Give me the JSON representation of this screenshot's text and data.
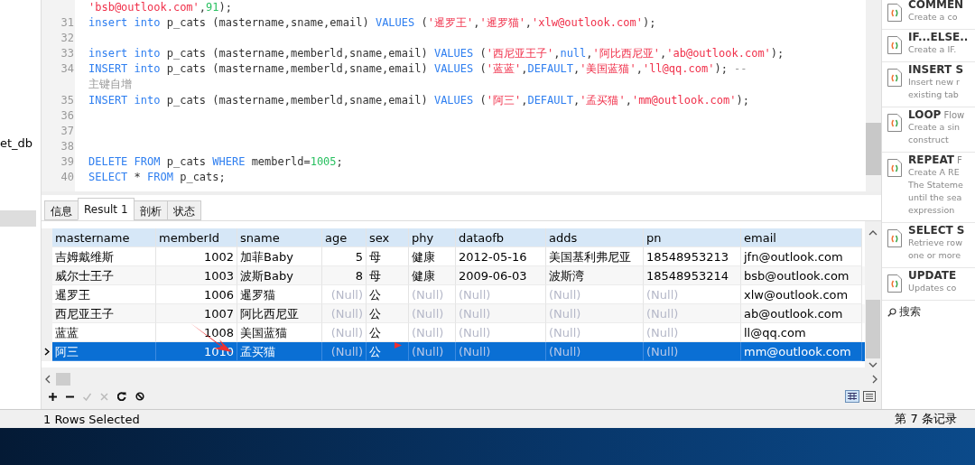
{
  "navigator": {
    "item_label": "et_db"
  },
  "editor": {
    "lines": [
      {
        "tokens": [
          {
            "kind": "str",
            "text": "'bsb@outlook.com'"
          },
          {
            "kind": "plain",
            "text": ","
          },
          {
            "kind": "num",
            "text": "91"
          },
          {
            "kind": "plain",
            "text": ");"
          }
        ]
      },
      {
        "number": "31",
        "tokens": [
          {
            "kind": "kw",
            "text": "insert into"
          },
          {
            "kind": "plain",
            "text": " p_cats (mastername,sname,email) "
          },
          {
            "kind": "kw",
            "text": "VALUES"
          },
          {
            "kind": "plain",
            "text": " ("
          },
          {
            "kind": "str",
            "text": "'暹罗王'"
          },
          {
            "kind": "plain",
            "text": ","
          },
          {
            "kind": "str",
            "text": "'暹罗猫'"
          },
          {
            "kind": "plain",
            "text": ","
          },
          {
            "kind": "str",
            "text": "'xlw@outlook.com'"
          },
          {
            "kind": "plain",
            "text": ");"
          }
        ]
      },
      {
        "number": "32"
      },
      {
        "number": "33",
        "tokens": [
          {
            "kind": "kw",
            "text": "insert into"
          },
          {
            "kind": "plain",
            "text": " p_cats (mastername,memberld,sname,email) "
          },
          {
            "kind": "kw",
            "text": "VALUES"
          },
          {
            "kind": "plain",
            "text": " ("
          },
          {
            "kind": "str",
            "text": "'西尼亚王子'"
          },
          {
            "kind": "plain",
            "text": ","
          },
          {
            "kind": "kw",
            "text": "null"
          },
          {
            "kind": "plain",
            "text": ","
          },
          {
            "kind": "str",
            "text": "'阿比西尼亚'"
          },
          {
            "kind": "plain",
            "text": ","
          },
          {
            "kind": "str",
            "text": "'ab@outlook.com'"
          },
          {
            "kind": "plain",
            "text": ");"
          }
        ]
      },
      {
        "number": "34",
        "tokens": [
          {
            "kind": "kw",
            "text": "INSERT into"
          },
          {
            "kind": "plain",
            "text": " p_cats (mastername,memberld,sname,email) "
          },
          {
            "kind": "kw",
            "text": "VALUES"
          },
          {
            "kind": "plain",
            "text": " ("
          },
          {
            "kind": "str",
            "text": "'蓝蓝'"
          },
          {
            "kind": "plain",
            "text": ","
          },
          {
            "kind": "kw",
            "text": "DEFAULT"
          },
          {
            "kind": "plain",
            "text": ","
          },
          {
            "kind": "str",
            "text": "'美国蓝猫'"
          },
          {
            "kind": "plain",
            "text": ","
          },
          {
            "kind": "str",
            "text": "'ll@qq.com'"
          },
          {
            "kind": "plain",
            "text": "); "
          },
          {
            "kind": "comment",
            "text": "--"
          }
        ]
      },
      {
        "tokens": [
          {
            "kind": "comment",
            "text": "主键自增"
          }
        ]
      },
      {
        "number": "35",
        "tokens": [
          {
            "kind": "kw",
            "text": "INSERT into"
          },
          {
            "kind": "plain",
            "text": " p_cats (mastername,memberld,sname,email) "
          },
          {
            "kind": "kw",
            "text": "VALUES"
          },
          {
            "kind": "plain",
            "text": " ("
          },
          {
            "kind": "str",
            "text": "'阿三'"
          },
          {
            "kind": "plain",
            "text": ","
          },
          {
            "kind": "kw",
            "text": "DEFAULT"
          },
          {
            "kind": "plain",
            "text": ","
          },
          {
            "kind": "str",
            "text": "'孟买猫'"
          },
          {
            "kind": "plain",
            "text": ","
          },
          {
            "kind": "str",
            "text": "'mm@outlook.com'"
          },
          {
            "kind": "plain",
            "text": ");"
          }
        ]
      },
      {
        "number": "36"
      },
      {
        "number": "37"
      },
      {
        "number": "38"
      },
      {
        "number": "39",
        "tokens": [
          {
            "kind": "kw",
            "text": "DELETE FROM"
          },
          {
            "kind": "plain",
            "text": " p_cats "
          },
          {
            "kind": "kw",
            "text": "WHERE"
          },
          {
            "kind": "plain",
            "text": " memberld="
          },
          {
            "kind": "num",
            "text": "1005"
          },
          {
            "kind": "plain",
            "text": ";"
          }
        ]
      },
      {
        "number": "40",
        "tokens": [
          {
            "kind": "kw",
            "text": "SELECT"
          },
          {
            "kind": "plain",
            "text": " * "
          },
          {
            "kind": "kw",
            "text": "FROM"
          },
          {
            "kind": "plain",
            "text": " p_cats;"
          }
        ]
      }
    ]
  },
  "tabs": [
    {
      "label": "信息",
      "selected": false
    },
    {
      "label": "Result 1",
      "selected": true
    },
    {
      "label": "剖析",
      "selected": false
    },
    {
      "label": "状态",
      "selected": false
    }
  ],
  "table": {
    "columns": [
      {
        "label": "mastername",
        "kind": "text"
      },
      {
        "label": "memberId",
        "kind": "number"
      },
      {
        "label": "sname",
        "kind": "text"
      },
      {
        "label": "age",
        "kind": "number"
      },
      {
        "label": "sex",
        "kind": "text"
      },
      {
        "label": "phy",
        "kind": "text"
      },
      {
        "label": "dataofb",
        "kind": "text"
      },
      {
        "label": "adds",
        "kind": "text"
      },
      {
        "label": "pn",
        "kind": "text"
      },
      {
        "label": "email",
        "kind": "text"
      }
    ],
    "rows": [
      {
        "selected": false,
        "cells": [
          {
            "text": "吉姆戴维斯",
            "null": false
          },
          {
            "text": "1002",
            "null": false
          },
          {
            "text": "加菲Baby",
            "null": false
          },
          {
            "text": "5",
            "null": false
          },
          {
            "text": "母",
            "null": false
          },
          {
            "text": "健康",
            "null": false
          },
          {
            "text": "2012-05-16",
            "null": false
          },
          {
            "text": "美国基利弗尼亚",
            "null": false
          },
          {
            "text": "18548953213",
            "null": false
          },
          {
            "text": "jfn@outlook.com",
            "null": false
          }
        ]
      },
      {
        "selected": false,
        "cells": [
          {
            "text": "威尔士王子",
            "null": false
          },
          {
            "text": "1003",
            "null": false
          },
          {
            "text": "波斯Baby",
            "null": false
          },
          {
            "text": "8",
            "null": false
          },
          {
            "text": "母",
            "null": false
          },
          {
            "text": "健康",
            "null": false
          },
          {
            "text": "2009-06-03",
            "null": false
          },
          {
            "text": "波斯湾",
            "null": false
          },
          {
            "text": "18548953214",
            "null": false
          },
          {
            "text": "bsb@outlook.com",
            "null": false
          }
        ]
      },
      {
        "selected": false,
        "cells": [
          {
            "text": "暹罗王",
            "null": false
          },
          {
            "text": "1006",
            "null": false
          },
          {
            "text": "暹罗猫",
            "null": false
          },
          {
            "text": "(Null)",
            "null": true
          },
          {
            "text": "公",
            "null": false
          },
          {
            "text": "(Null)",
            "null": true
          },
          {
            "text": "(Null)",
            "null": true
          },
          {
            "text": "(Null)",
            "null": true
          },
          {
            "text": "(Null)",
            "null": true
          },
          {
            "text": "xlw@outlook.com",
            "null": false
          }
        ]
      },
      {
        "selected": false,
        "cells": [
          {
            "text": "西尼亚王子",
            "null": false
          },
          {
            "text": "1007",
            "null": false
          },
          {
            "text": "阿比西尼亚",
            "null": false
          },
          {
            "text": "(Null)",
            "null": true
          },
          {
            "text": "公",
            "null": false
          },
          {
            "text": "(Null)",
            "null": true
          },
          {
            "text": "(Null)",
            "null": true
          },
          {
            "text": "(Null)",
            "null": true
          },
          {
            "text": "(Null)",
            "null": true
          },
          {
            "text": "ab@outlook.com",
            "null": false
          }
        ]
      },
      {
        "selected": false,
        "cells": [
          {
            "text": "蓝蓝",
            "null": false
          },
          {
            "text": "1008",
            "null": false
          },
          {
            "text": "美国蓝猫",
            "null": false
          },
          {
            "text": "(Null)",
            "null": true
          },
          {
            "text": "公",
            "null": false
          },
          {
            "text": "(Null)",
            "null": true
          },
          {
            "text": "(Null)",
            "null": true
          },
          {
            "text": "(Null)",
            "null": true
          },
          {
            "text": "(Null)",
            "null": true
          },
          {
            "text": "ll@qq.com",
            "null": false
          }
        ]
      },
      {
        "selected": true,
        "cells": [
          {
            "text": "阿三",
            "null": false
          },
          {
            "text": "1010",
            "null": false
          },
          {
            "text": "孟买猫",
            "null": false
          },
          {
            "text": "(Null)",
            "null": true
          },
          {
            "text": "公",
            "null": false
          },
          {
            "text": "(Null)",
            "null": true
          },
          {
            "text": "(Null)",
            "null": true
          },
          {
            "text": "(Null)",
            "null": true
          },
          {
            "text": "(Null)",
            "null": true
          },
          {
            "text": "mm@outlook.com",
            "null": false
          }
        ]
      }
    ]
  },
  "status_bar": {
    "left": "1 Rows Selected",
    "right": "第 7 条记录"
  },
  "snippets": {
    "items": [
      {
        "title": "COMMEN",
        "description": [
          "Create a co"
        ]
      },
      {
        "title": "IF...ELSE..",
        "description": [
          "Create a IF."
        ]
      },
      {
        "title": "INSERT S",
        "description": [
          "Insert new r",
          "existing tab"
        ]
      },
      {
        "title": "LOOP",
        "subtitle": "Flow",
        "description": [
          "Create a sin",
          "construct"
        ]
      },
      {
        "title": "REPEAT",
        "subtitle": "F",
        "description": [
          "Create A RE",
          "The Stateme",
          "until the sea",
          "expression"
        ]
      },
      {
        "title": "SELECT S",
        "description": [
          "Retrieve row",
          "one or more"
        ]
      },
      {
        "title": "UPDATE",
        "description": [
          "Updates co"
        ]
      }
    ],
    "search_placeholder": "搜索"
  }
}
